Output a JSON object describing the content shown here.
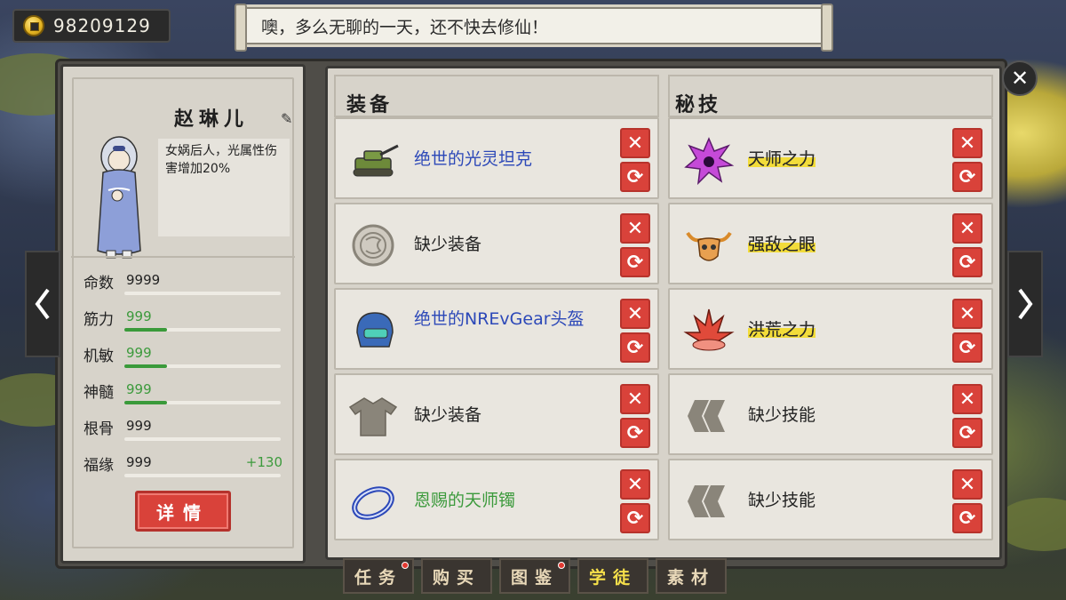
{
  "currency": {
    "value": "98209129",
    "icon": "coin-icon"
  },
  "message": "噢，多么无聊的一天，还不快去修仙！",
  "character": {
    "name": "赵琳儿",
    "description": "女娲后人，光属性伤害增加20%",
    "stats": [
      {
        "label": "命数",
        "value": "9999",
        "highlight": false,
        "bar": 0.0,
        "bonus": ""
      },
      {
        "label": "筋力",
        "value": "999",
        "highlight": true,
        "bar": 0.27,
        "bonus": ""
      },
      {
        "label": "机敏",
        "value": "999",
        "highlight": true,
        "bar": 0.27,
        "bonus": ""
      },
      {
        "label": "神髓",
        "value": "999",
        "highlight": true,
        "bar": 0.27,
        "bonus": ""
      },
      {
        "label": "根骨",
        "value": "999",
        "highlight": false,
        "bar": 0.0,
        "bonus": ""
      },
      {
        "label": "福缘",
        "value": "999",
        "highlight": false,
        "bar": 0.0,
        "bonus": "+130"
      }
    ],
    "detail_button": "详情"
  },
  "equipment": {
    "title": "装备",
    "slots": [
      {
        "name": "绝世的光灵坦克",
        "style": "blue",
        "icon": "tank-icon"
      },
      {
        "name": "缺少装备",
        "style": "plain",
        "icon": "empty-medallion-icon"
      },
      {
        "name": "绝世的NREvGear头盔",
        "style": "blue",
        "icon": "helmet-icon"
      },
      {
        "name": "缺少装备",
        "style": "plain",
        "icon": "robe-icon"
      },
      {
        "name": "恩赐的天师镯",
        "style": "green",
        "icon": "bracelet-icon"
      }
    ]
  },
  "skills": {
    "title": "秘技",
    "slots": [
      {
        "name": "天师之力",
        "style": "gold",
        "icon": "purple-burst-icon"
      },
      {
        "name": "强敌之眼",
        "style": "gold",
        "icon": "bull-skull-icon"
      },
      {
        "name": "洪荒之力",
        "style": "gold",
        "icon": "red-flame-icon"
      },
      {
        "name": "缺少技能",
        "style": "plain",
        "icon": "empty-skill-icon"
      },
      {
        "name": "缺少技能",
        "style": "plain",
        "icon": "empty-skill-icon"
      }
    ]
  },
  "tabs": [
    {
      "label": "任务",
      "badge": true,
      "active": false
    },
    {
      "label": "购买",
      "badge": false,
      "active": false
    },
    {
      "label": "图鉴",
      "badge": true,
      "active": false
    },
    {
      "label": "学徒",
      "badge": false,
      "active": true
    },
    {
      "label": "素材",
      "badge": false,
      "active": false
    }
  ],
  "colors": {
    "accent_red": "#d9423a",
    "equip_blue": "#2c48b8",
    "stat_green": "#3c9a3c",
    "skill_gold": "#f2dc3a"
  }
}
